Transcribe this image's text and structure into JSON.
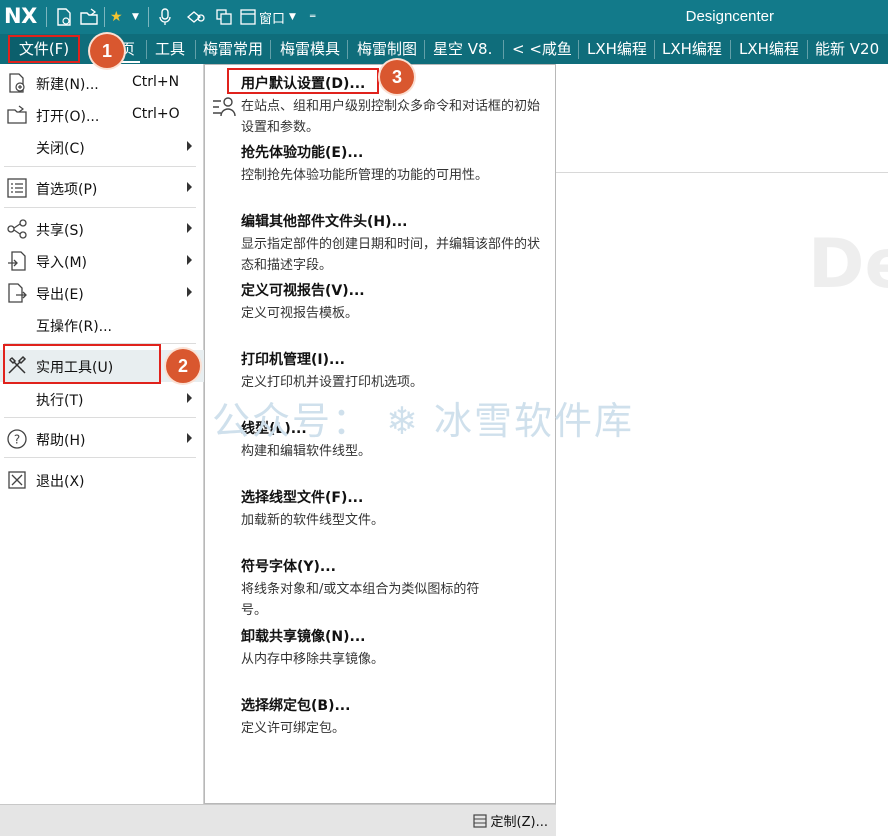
{
  "titlebar": {
    "logo": "NX",
    "window_menu_label": "窗口",
    "app_title": "Designcenter"
  },
  "tabs": [
    {
      "label": "文件(F)"
    },
    {
      "label": "页"
    },
    {
      "label": "工具"
    },
    {
      "label": "梅雷常用"
    },
    {
      "label": "梅雷模具"
    },
    {
      "label": "梅雷制图"
    },
    {
      "label": "星空 V8."
    },
    {
      "label": "< <咸鱼"
    },
    {
      "label": "LXH编程"
    },
    {
      "label": "LXH编程"
    },
    {
      "label": "LXH编程"
    },
    {
      "label": "能新 V20"
    }
  ],
  "file_menu": {
    "items": [
      {
        "label": "新建(N)...",
        "shortcut": "Ctrl+N",
        "icon": "new-file-icon"
      },
      {
        "label": "打开(O)...",
        "shortcut": "Ctrl+O",
        "icon": "open-folder-icon"
      },
      {
        "label": "关闭(C)",
        "icon": ""
      },
      {
        "label": "首选项(P)",
        "icon": "preferences-icon"
      },
      {
        "label": "共享(S)",
        "icon": "share-icon"
      },
      {
        "label": "导入(M)",
        "icon": "import-icon"
      },
      {
        "label": "导出(E)",
        "icon": "export-icon"
      },
      {
        "label": "互操作(R)...",
        "icon": ""
      },
      {
        "label": "实用工具(U)",
        "icon": "tools-icon"
      },
      {
        "label": "执行(T)",
        "icon": ""
      },
      {
        "label": "帮助(H)",
        "icon": "help-icon"
      },
      {
        "label": "退出(X)",
        "icon": "exit-icon"
      }
    ]
  },
  "sub_menu": {
    "items": [
      {
        "title": "用户默认设置(D)...",
        "desc": "在站点、组和用户级别控制众多命令和对话框的初始设置和参数。"
      },
      {
        "title": "抢先体验功能(E)...",
        "desc": "控制抢先体验功能所管理的功能的可用性。"
      },
      {
        "title": "编辑其他部件文件头(H)...",
        "desc": "显示指定部件的创建日期和时间，并编辑该部件的状态和描述字段。"
      },
      {
        "title": "定义可视报告(V)...",
        "desc": "定义可视报告模板。"
      },
      {
        "title": "打印机管理(I)...",
        "desc": "定义打印机并设置打印机选项。"
      },
      {
        "title": "线型(L)...",
        "desc": "构建和编辑软件线型。"
      },
      {
        "title": "选择线型文件(F)...",
        "desc": "加载新的软件线型文件。"
      },
      {
        "title": "符号字体(Y)...",
        "desc": "将线条对象和/或文本组合为类似图标的符号。"
      },
      {
        "title": "卸载共享镜像(N)...",
        "desc": "从内存中移除共享镜像。"
      },
      {
        "title": "选择绑定包(B)...",
        "desc": "定义许可绑定包。"
      }
    ]
  },
  "customize_label": "定制(Z)...",
  "badges": {
    "one": "1",
    "two": "2",
    "three": "3"
  },
  "watermark": "公众号： ❄ 冰雪软件库",
  "background_text": "De",
  "colors": {
    "titlebar": "#127a8a",
    "tabbar": "#0f6d7b",
    "highlight": "#e0221c",
    "badge": "#d9572f"
  }
}
